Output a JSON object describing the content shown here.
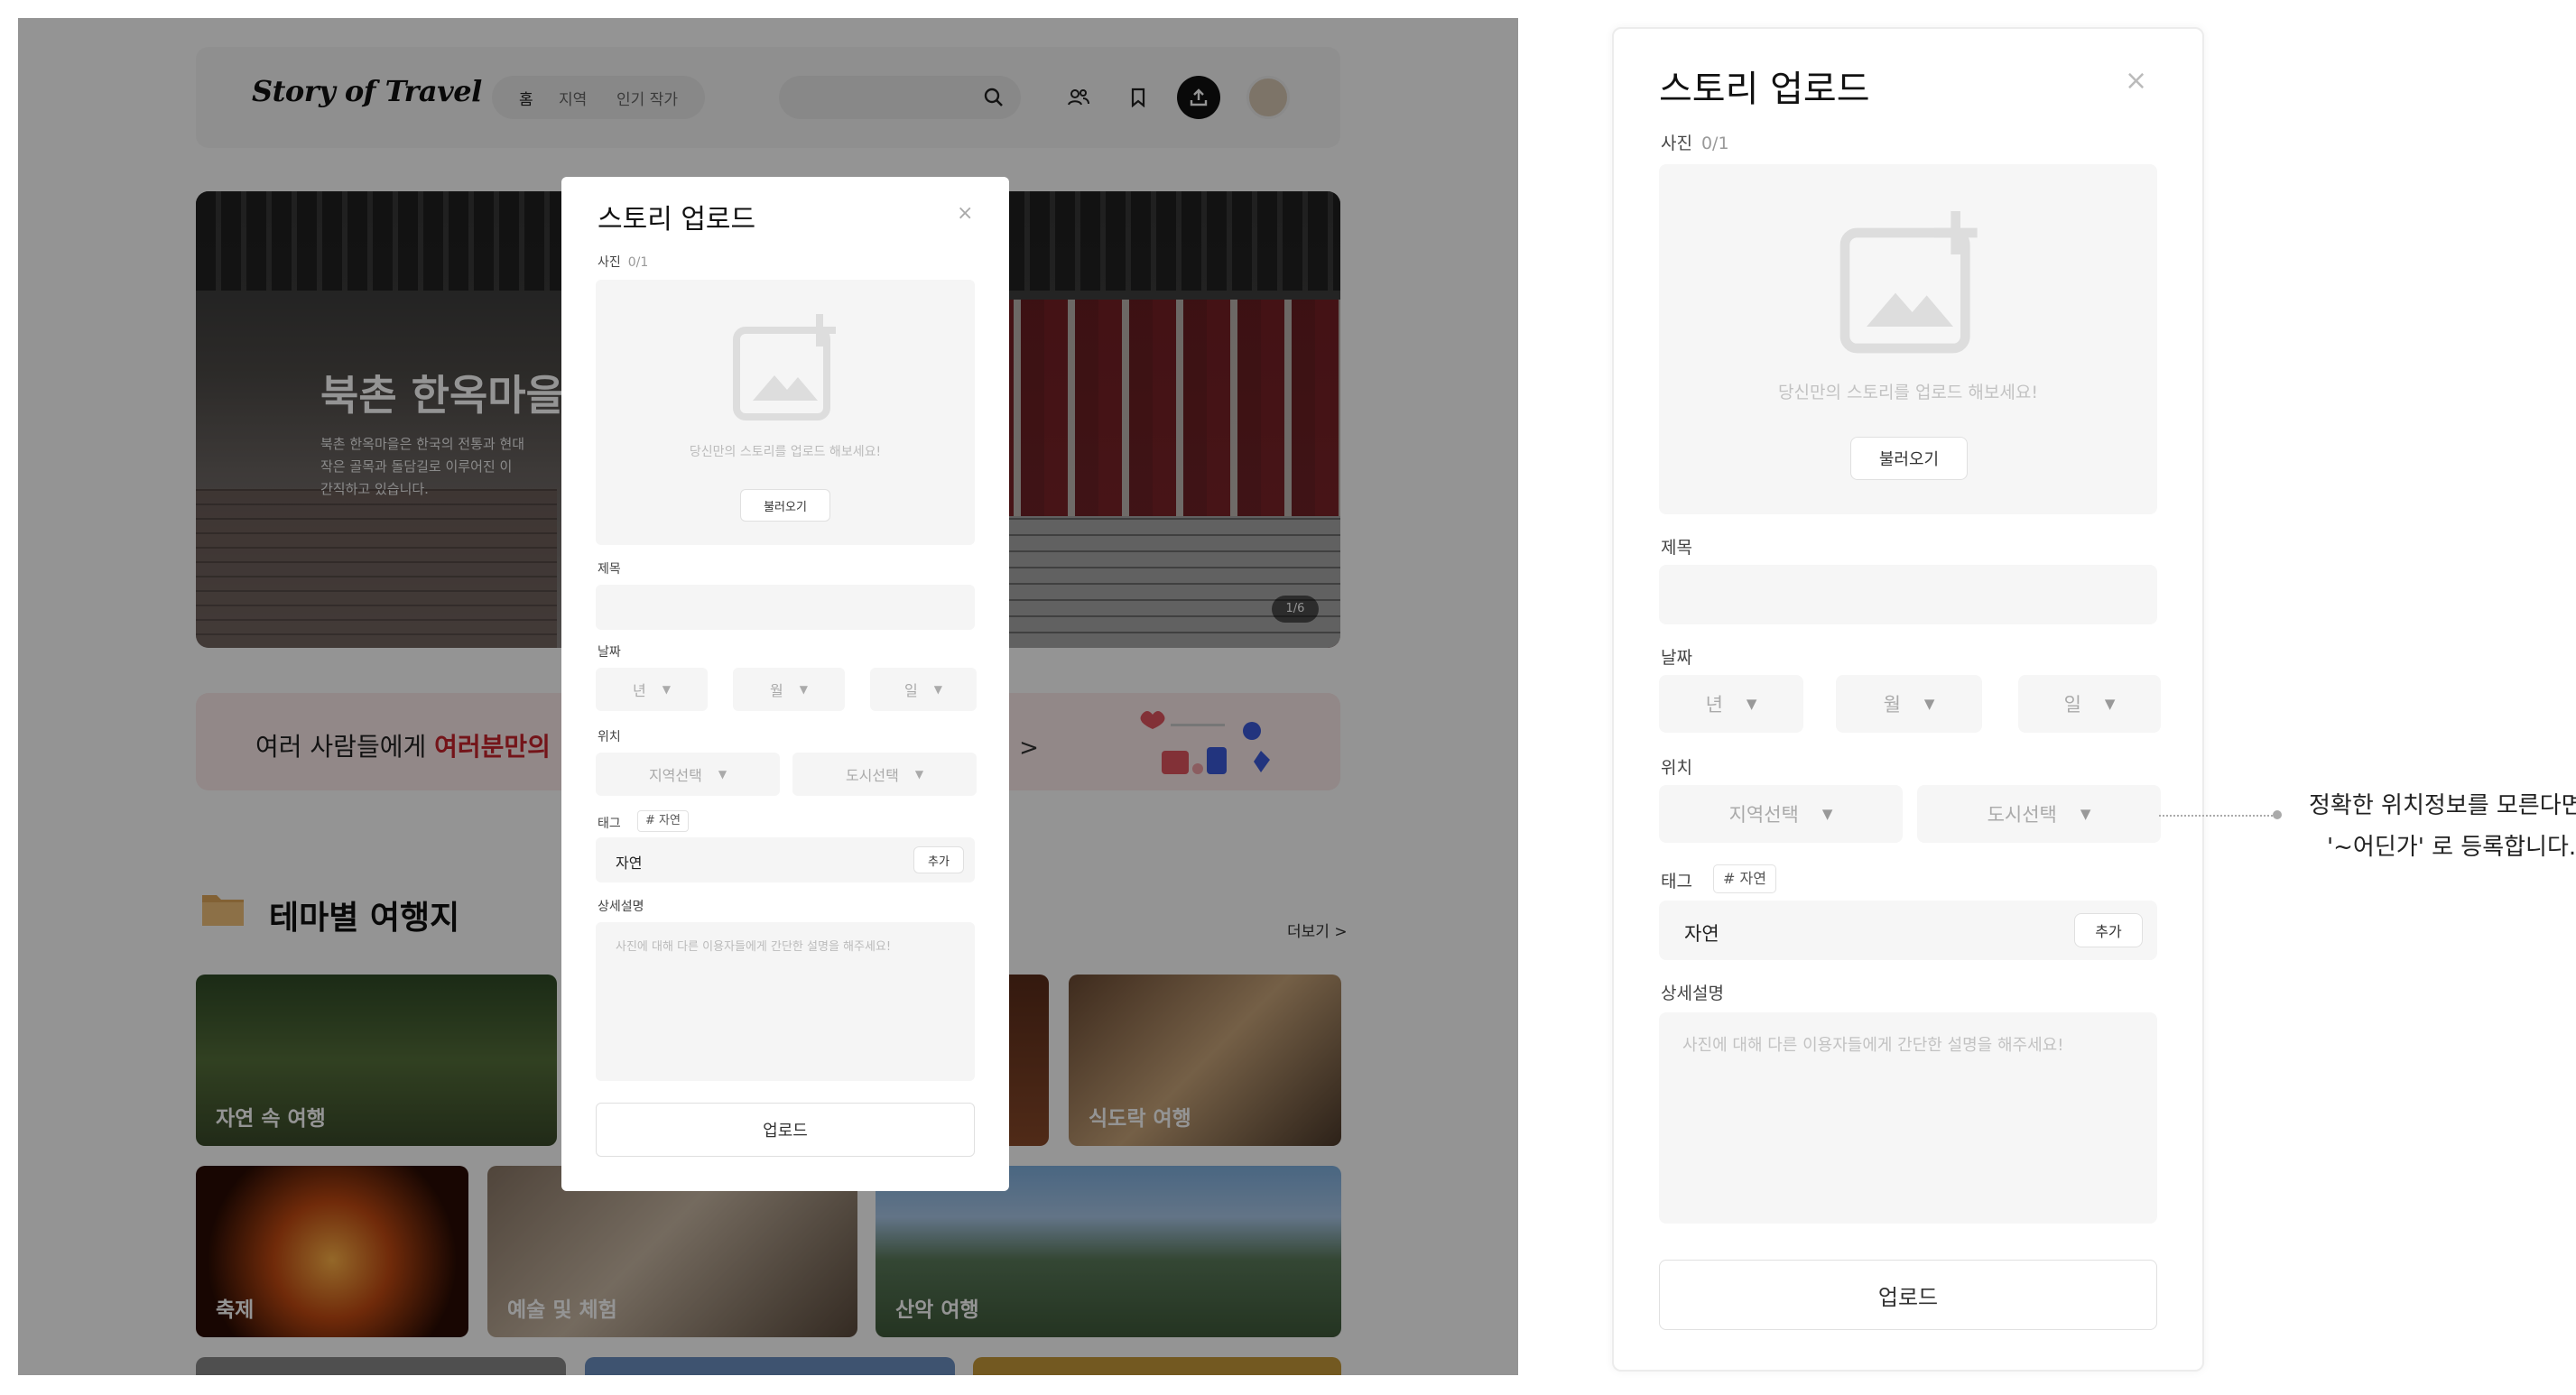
{
  "app": {
    "logo": "Story of Travel",
    "nav": [
      "홈",
      "지역",
      "인기 작가"
    ]
  },
  "hero": {
    "title": "북촌 한옥마을",
    "desc_line1": "북촌 한옥마을은 한국의 전통과 현대",
    "desc_line2": "작은 골목과 돌담길로 이루어진 이",
    "desc_line3": "간직하고 있습니다.",
    "counter": "1/6"
  },
  "banner": {
    "text_prefix": "여러 사람들에게 ",
    "text_highlight": "여러분만의",
    "more": "기 >"
  },
  "themes": {
    "title": "테마별 여행지",
    "more": "더보기 >",
    "cards": [
      "자연 속 여행",
      "식도락 여행",
      "축제",
      "예술 및 체험",
      "산악 여행"
    ]
  },
  "modal": {
    "title": "스토리 업로드",
    "close": "×",
    "photo_label": "사진",
    "photo_count": "0/1",
    "photo_hint": "당신만의 스토리를 업로드 해보세요!",
    "load_button": "불러오기",
    "title_label": "제목",
    "date_label": "날짜",
    "year": "년",
    "month": "월",
    "day": "일",
    "location_label": "위치",
    "region_select": "지역선택",
    "city_select": "도시선택",
    "tag_label": "태그",
    "tag_chip": "# 자연",
    "tag_value": "자연",
    "tag_add": "추가",
    "desc_label": "상세설명",
    "desc_placeholder": "사진에 대해 다른 이용자들에게 간단한 설명을 해주세요!",
    "upload_button": "업로드"
  },
  "annotation": {
    "line1": "정확한 위치정보를 모른다면",
    "line2": "'~어딘가' 로 등록합니다."
  },
  "colors": {
    "accent_red": "#c8232c",
    "overlay": "rgba(0,0,0,0.42)",
    "field_bg": "#f5f5f5"
  },
  "icons": [
    "search-icon",
    "people-icon",
    "bookmark-icon",
    "upload-icon",
    "image-add-icon",
    "close-icon",
    "chevron-down-icon",
    "folder-icon"
  ]
}
